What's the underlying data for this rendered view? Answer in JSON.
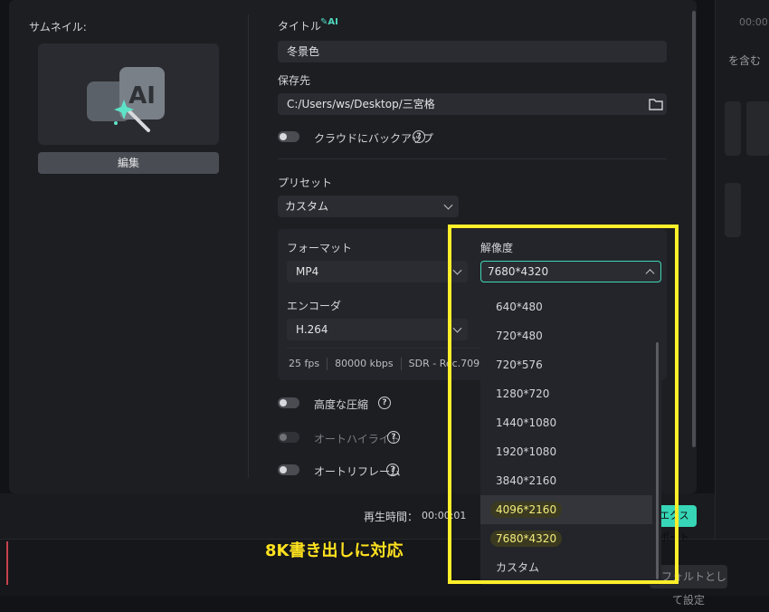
{
  "thumbnail": {
    "label": "サムネイル:",
    "edit_button": "編集"
  },
  "title": {
    "label": "タイトル",
    "ai_badge": "AI",
    "value": "冬景色"
  },
  "save_location": {
    "label": "保存先",
    "value": "C:/Users/ws/Desktop/三宮格"
  },
  "cloud_backup": {
    "label": "クラウドにバックアップ"
  },
  "preset": {
    "label": "プリセット",
    "value": "カスタム"
  },
  "format": {
    "label": "フォーマット",
    "value": "MP4"
  },
  "resolution": {
    "label": "解像度",
    "value": "7680*4320",
    "options": [
      "640*480",
      "720*480",
      "720*576",
      "1280*720",
      "1440*1080",
      "1920*1080",
      "3840*2160",
      "4096*2160",
      "7680*4320",
      "カスタム"
    ]
  },
  "encoder": {
    "label": "エンコーダ",
    "value": "H.264"
  },
  "stats": {
    "fps": "25 fps",
    "bitrate": "80000 kbps",
    "color": "SDR - Rec.709"
  },
  "toggles": {
    "advanced_compression": "高度な圧縮",
    "auto_highlight": "オートハイライト",
    "auto_reframe": "オートリフレーム"
  },
  "footer": {
    "duration_label": "再生時間：",
    "duration_value": "00:00:01",
    "export_button": "エクスポート"
  },
  "background": {
    "timestamp": "00:00",
    "include": "を含む",
    "bottom_button": "デフォルトとして設定"
  },
  "promo_text": "8K書き出しに対応",
  "colors": {
    "accent": "#36d6b6",
    "highlight": "#ffef2a",
    "dialog_bg": "#1d1e22"
  }
}
